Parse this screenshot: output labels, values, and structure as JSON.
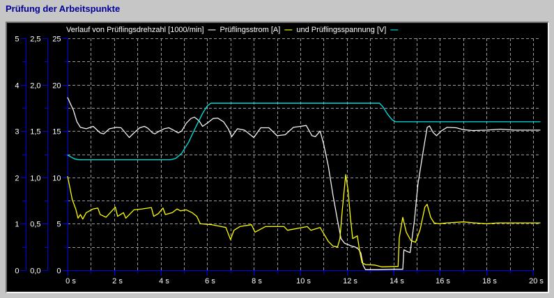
{
  "title": "Prüfung der Arbeitspunkte",
  "colors": {
    "window_background": "#c6c6c6",
    "panel_background": "#000000",
    "title_text": "#000099",
    "axis": "#0000f0",
    "grid": "#9a9a9a",
    "label_text": "#ffffff",
    "series_drehzahl": "#f5f5f5",
    "series_strom": "#ffff00",
    "series_spannung": "#00e8e8"
  },
  "legend": {
    "dash": "—",
    "items": [
      {
        "label": "Verlauf von Prüflingsdrehzahl [1000/min]",
        "color": "#f5f5f5"
      },
      {
        "label": "Prüflingsstrom [A]",
        "color": "#ffff00"
      },
      {
        "label": "und Prüflingsspannung [V]",
        "color": "#00e8e8"
      }
    ]
  },
  "chart_data": {
    "type": "line",
    "grid": "dashed",
    "x_axis": {
      "min": 0,
      "max": 20,
      "unit": "s",
      "major_step": 2,
      "minor_step": 1,
      "tick_labels": [
        "0 s",
        "2 s",
        "4 s",
        "6 s",
        "8 s",
        "10 s",
        "12 s",
        "14 s",
        "16 s",
        "18 s",
        "20 s"
      ]
    },
    "y_axes": [
      {
        "name": "Prüflingsdrehzahl",
        "unit": "1000/min",
        "min": 0,
        "max": 5,
        "tick_labels": [
          "0",
          "1",
          "2",
          "3",
          "4",
          "5"
        ]
      },
      {
        "name": "Prüflingsstrom",
        "unit": "A",
        "min": 0,
        "max": 2.5,
        "tick_labels": [
          "0,0",
          "0,5",
          "1,0",
          "1,5",
          "2,0",
          "2,5"
        ]
      },
      {
        "name": "Prüflingsspannung",
        "unit": "V",
        "min": 0,
        "max": 25,
        "tick_labels": [
          "0",
          "5",
          "10",
          "15",
          "20",
          "25"
        ]
      }
    ],
    "series": [
      {
        "name": "Prüflingsdrehzahl [1000/min]",
        "color": "#f5f5f5",
        "y_axis": 0,
        "points": [
          [
            0,
            3.72
          ],
          [
            0.25,
            3.45
          ],
          [
            0.4,
            3.2
          ],
          [
            0.55,
            3.08
          ],
          [
            0.8,
            3.05
          ],
          [
            1.1,
            3.1
          ],
          [
            1.4,
            2.96
          ],
          [
            1.55,
            2.94
          ],
          [
            1.8,
            3.05
          ],
          [
            2.1,
            3.08
          ],
          [
            2.3,
            3.07
          ],
          [
            2.45,
            2.98
          ],
          [
            2.65,
            2.86
          ],
          [
            2.85,
            2.96
          ],
          [
            3.1,
            3.07
          ],
          [
            3.3,
            3.1
          ],
          [
            3.45,
            3.06
          ],
          [
            3.65,
            2.96
          ],
          [
            3.75,
            2.94
          ],
          [
            3.95,
            3.0
          ],
          [
            4.15,
            3.05
          ],
          [
            4.35,
            3.07
          ],
          [
            4.55,
            3.02
          ],
          [
            4.75,
            2.96
          ],
          [
            4.9,
            3.0
          ],
          [
            5.1,
            3.17
          ],
          [
            5.3,
            3.27
          ],
          [
            5.45,
            3.3
          ],
          [
            5.65,
            3.22
          ],
          [
            5.8,
            3.1
          ],
          [
            6.0,
            3.17
          ],
          [
            6.25,
            3.27
          ],
          [
            6.45,
            3.28
          ],
          [
            6.7,
            3.2
          ],
          [
            6.9,
            3.05
          ],
          [
            7.05,
            2.88
          ],
          [
            7.3,
            3.05
          ],
          [
            7.6,
            3.02
          ],
          [
            8.0,
            2.86
          ],
          [
            8.3,
            3.07
          ],
          [
            8.65,
            3.07
          ],
          [
            9.0,
            2.9
          ],
          [
            9.35,
            2.92
          ],
          [
            9.7,
            3.08
          ],
          [
            10.0,
            3.1
          ],
          [
            10.25,
            3.12
          ],
          [
            10.5,
            2.9
          ],
          [
            10.65,
            2.88
          ],
          [
            10.85,
            3.0
          ],
          [
            11.0,
            2.72
          ],
          [
            11.2,
            2.25
          ],
          [
            11.4,
            1.62
          ],
          [
            11.6,
            1.07
          ],
          [
            11.75,
            0.68
          ],
          [
            11.9,
            0.58
          ],
          [
            12.05,
            0.55
          ],
          [
            12.2,
            0.52
          ],
          [
            12.35,
            0.5
          ],
          [
            12.5,
            0.45
          ],
          [
            12.6,
            0.37
          ],
          [
            12.7,
            0.1
          ],
          [
            12.8,
            0.01
          ],
          [
            13.4,
            0.01
          ],
          [
            14.0,
            0.02
          ],
          [
            14.4,
            0.02
          ],
          [
            14.45,
            0.44
          ],
          [
            14.6,
            0.4
          ],
          [
            14.72,
            0.38
          ],
          [
            14.9,
            1.07
          ],
          [
            15.05,
            1.85
          ],
          [
            15.3,
            2.63
          ],
          [
            15.45,
            3.08
          ],
          [
            15.55,
            3.11
          ],
          [
            15.7,
            2.97
          ],
          [
            15.85,
            2.9
          ],
          [
            16.05,
            3.0
          ],
          [
            16.3,
            3.08
          ],
          [
            16.7,
            3.07
          ],
          [
            17.0,
            3.03
          ],
          [
            17.4,
            3.01
          ],
          [
            18.0,
            3.02
          ],
          [
            18.6,
            3.04
          ],
          [
            19.2,
            3.02
          ],
          [
            20.3,
            3.02
          ]
        ]
      },
      {
        "name": "Prüflingsstrom [A]",
        "color": "#ffff00",
        "y_axis": 1,
        "points": [
          [
            0,
            1.01
          ],
          [
            0.1,
            0.89
          ],
          [
            0.2,
            0.76
          ],
          [
            0.35,
            0.66
          ],
          [
            0.45,
            0.56
          ],
          [
            0.55,
            0.6
          ],
          [
            0.65,
            0.55
          ],
          [
            0.8,
            0.62
          ],
          [
            1.1,
            0.66
          ],
          [
            1.3,
            0.67
          ],
          [
            1.4,
            0.6
          ],
          [
            1.65,
            0.57
          ],
          [
            1.8,
            0.61
          ],
          [
            2.05,
            0.68
          ],
          [
            2.15,
            0.58
          ],
          [
            2.4,
            0.62
          ],
          [
            2.5,
            0.56
          ],
          [
            2.85,
            0.65
          ],
          [
            3.2,
            0.66
          ],
          [
            3.6,
            0.675
          ],
          [
            3.7,
            0.58
          ],
          [
            3.9,
            0.61
          ],
          [
            4.1,
            0.67
          ],
          [
            4.2,
            0.6
          ],
          [
            4.5,
            0.62
          ],
          [
            4.7,
            0.66
          ],
          [
            4.85,
            0.64
          ],
          [
            5.1,
            0.65
          ],
          [
            5.35,
            0.62
          ],
          [
            5.55,
            0.58
          ],
          [
            5.7,
            0.5
          ],
          [
            6.2,
            0.49
          ],
          [
            6.6,
            0.47
          ],
          [
            6.8,
            0.46
          ],
          [
            7.0,
            0.33
          ],
          [
            7.15,
            0.43
          ],
          [
            7.4,
            0.47
          ],
          [
            7.9,
            0.49
          ],
          [
            8.05,
            0.41
          ],
          [
            8.5,
            0.47
          ],
          [
            9.3,
            0.47
          ],
          [
            9.45,
            0.43
          ],
          [
            10.3,
            0.47
          ],
          [
            10.45,
            0.43
          ],
          [
            10.85,
            0.46
          ],
          [
            11.2,
            0.31
          ],
          [
            11.4,
            0.26
          ],
          [
            11.6,
            0.25
          ],
          [
            11.7,
            0.34
          ],
          [
            11.8,
            0.64
          ],
          [
            11.95,
            1.03
          ],
          [
            12.05,
            0.86
          ],
          [
            12.15,
            0.57
          ],
          [
            12.25,
            0.34
          ],
          [
            12.45,
            0.37
          ],
          [
            12.55,
            0.2
          ],
          [
            12.65,
            0.08
          ],
          [
            12.8,
            0.06
          ],
          [
            13.2,
            0.055
          ],
          [
            13.5,
            0.035
          ],
          [
            14.1,
            0.04
          ],
          [
            14.2,
            0.04
          ],
          [
            14.25,
            0.35
          ],
          [
            14.4,
            0.57
          ],
          [
            14.55,
            0.41
          ],
          [
            14.75,
            0.32
          ],
          [
            14.95,
            0.3
          ],
          [
            15.15,
            0.44
          ],
          [
            15.35,
            0.68
          ],
          [
            15.45,
            0.71
          ],
          [
            15.6,
            0.57
          ],
          [
            15.75,
            0.51
          ],
          [
            15.95,
            0.5
          ],
          [
            16.3,
            0.51
          ],
          [
            17.0,
            0.52
          ],
          [
            17.5,
            0.51
          ],
          [
            18.0,
            0.5
          ],
          [
            18.5,
            0.51
          ],
          [
            19.0,
            0.51
          ],
          [
            19.5,
            0.51
          ],
          [
            20.3,
            0.51
          ]
        ]
      },
      {
        "name": "Prüflingsspannung [V]",
        "color": "#00e8e8",
        "y_axis": 2,
        "points": [
          [
            0,
            12.4
          ],
          [
            0.3,
            12.0
          ],
          [
            0.5,
            11.9
          ],
          [
            4.4,
            11.9
          ],
          [
            4.65,
            12.05
          ],
          [
            4.9,
            12.6
          ],
          [
            5.2,
            13.8
          ],
          [
            5.5,
            15.4
          ],
          [
            5.8,
            16.9
          ],
          [
            6.0,
            17.7
          ],
          [
            6.15,
            18.0
          ],
          [
            13.4,
            18.0
          ],
          [
            13.55,
            17.6
          ],
          [
            13.75,
            16.8
          ],
          [
            13.95,
            16.2
          ],
          [
            14.1,
            16.0
          ],
          [
            20.3,
            16.0
          ]
        ]
      }
    ]
  }
}
